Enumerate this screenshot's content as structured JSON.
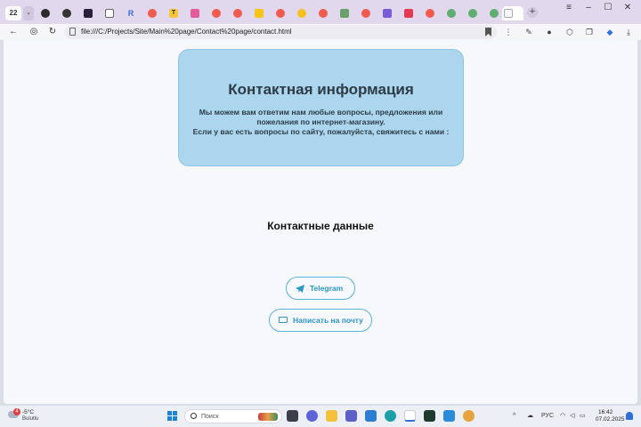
{
  "browser": {
    "tab_count": "22",
    "url": "file:///C:/Projects/Site/Main%20page/Contact%20page/contact.html"
  },
  "page": {
    "info_title": "Контактная информация",
    "info_text_line1": "Мы можем вам ответим нам любые вопросы, предложения или пожелания по интернет-магазину.",
    "info_text_line2": "Если у вас есть вопросы по сайту, пожалуйста, свяжитесь с нами :",
    "contacts_heading": "Контактные данные",
    "telegram_label": "Telegram",
    "email_label": "Написать на почту"
  },
  "taskbar": {
    "weather_temp": "-5°C",
    "weather_condition": "Bulutlu",
    "weather_badge": "4",
    "search_placeholder": "Поиск",
    "language": "РУС",
    "time": "16:42",
    "date": "07.02.2025"
  },
  "colors": {
    "card_background": "#acd6ee",
    "link_accent": "#2c96c8",
    "tabstrip": "#e1d8ee"
  }
}
